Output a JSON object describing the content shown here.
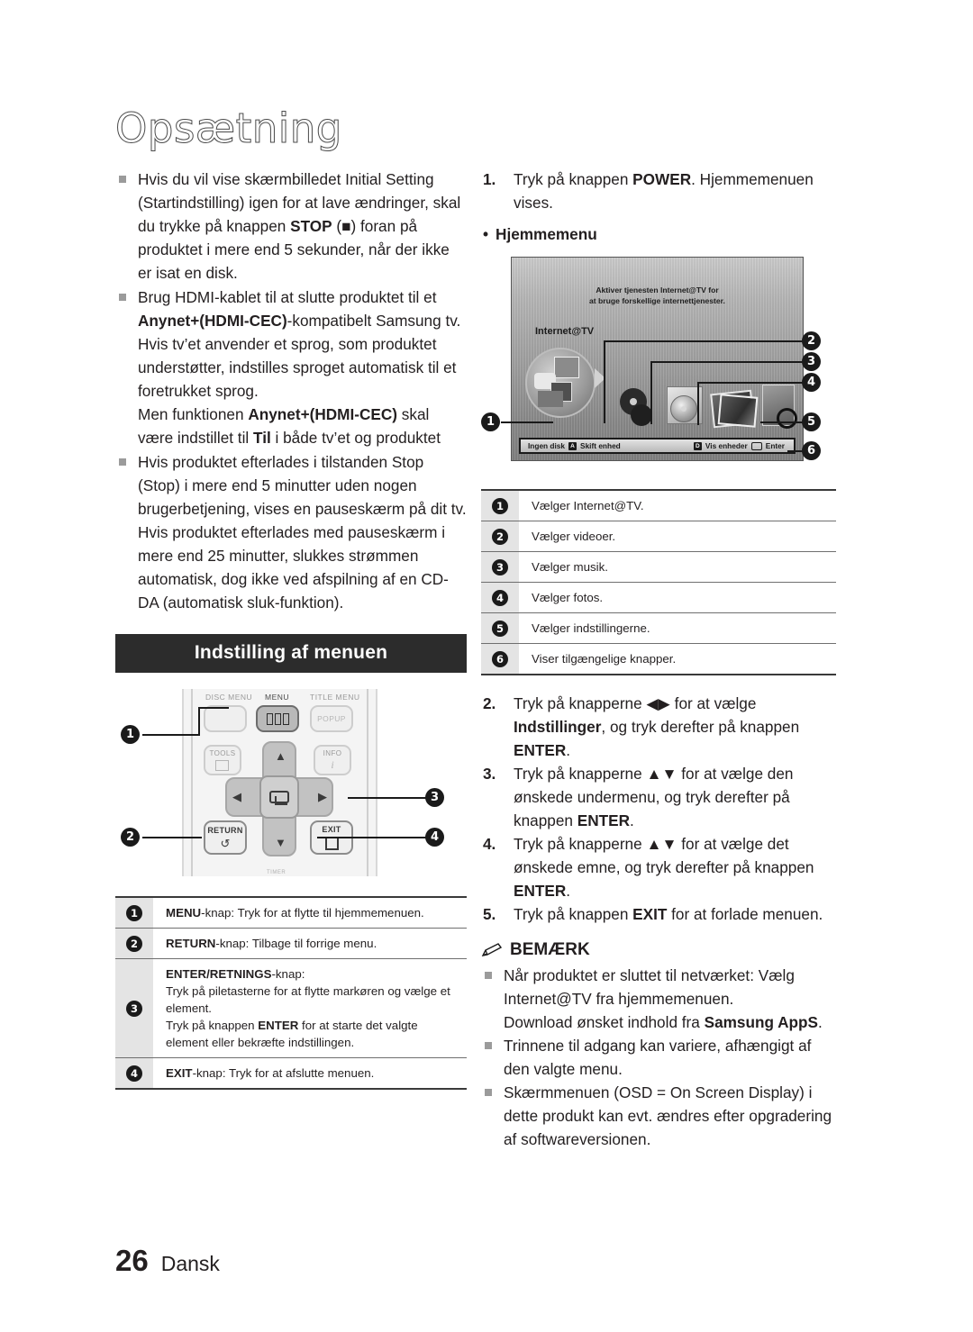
{
  "page": {
    "title": "Opsætning",
    "number": "26",
    "language": "Dansk"
  },
  "left_column": {
    "bullets": [
      {
        "parts": [
          {
            "t": "Hvis du vil vise skærmbilledet Initial Setting (Startindstilling) igen for at lave ændringer, skal du trykke på knappen ",
            "b": false
          },
          {
            "t": "STOP",
            "b": true
          },
          {
            "t": " (■) foran på produktet i mere end 5 sekunder, når der ikke er isat en disk.",
            "b": false
          }
        ]
      },
      {
        "parts": [
          {
            "t": "Brug HDMI-kablet til at slutte produktet til et ",
            "b": false
          },
          {
            "t": "Anynet+(HDMI-CEC)",
            "b": true
          },
          {
            "t": "-kompatibelt Samsung tv. Hvis tv’et anvender et sprog, som produktet understøtter, indstilles sproget automatisk til et foretrukket sprog.",
            "b": false
          },
          {
            "t": "\nMen funktionen ",
            "b": false
          },
          {
            "t": "Anynet+(HDMI-CEC)",
            "b": true
          },
          {
            "t": " skal være indstillet til ",
            "b": false
          },
          {
            "t": "Til",
            "b": true
          },
          {
            "t": " i både tv’et og produktet",
            "b": false
          }
        ]
      },
      {
        "parts": [
          {
            "t": "Hvis produktet efterlades i tilstanden Stop (Stop) i mere end 5 minutter uden nogen brugerbetjening, vises en pauseskærm på dit tv. Hvis produktet efterlades med pauseskærm i mere end 25 minutter, slukkes strømmen automatisk, dog ikke ved afspilning af en CD-DA (automatisk sluk-funktion).",
            "b": false
          }
        ]
      }
    ],
    "section_header": "Indstilling af menuen",
    "remote": {
      "labels": {
        "disc_menu": "DISC MENU",
        "menu": "MENU",
        "title_menu": "TITLE MENU",
        "popup": "POPUP",
        "tools": "TOOLS",
        "info": "INFO",
        "return": "RETURN",
        "exit": "EXIT",
        "timer": "TIMER"
      },
      "callouts": [
        "1",
        "2",
        "3",
        "4"
      ]
    },
    "remote_table": [
      {
        "num": "1",
        "lines": [
          [
            {
              "t": "MENU",
              "b": true
            },
            {
              "t": "-knap: Tryk for at flytte til hjemmemenuen.",
              "b": false
            }
          ]
        ]
      },
      {
        "num": "2",
        "lines": [
          [
            {
              "t": "RETURN",
              "b": true
            },
            {
              "t": "-knap: Tilbage til forrige menu.",
              "b": false
            }
          ]
        ]
      },
      {
        "num": "3",
        "lines": [
          [
            {
              "t": "ENTER/RETNINGS",
              "b": true
            },
            {
              "t": "-knap:",
              "b": false
            }
          ],
          [
            {
              "t": "Tryk på piletasterne for at flytte markøren og vælge et element.",
              "b": false
            }
          ],
          [
            {
              "t": "Tryk på knappen ",
              "b": false
            },
            {
              "t": "ENTER",
              "b": true
            },
            {
              "t": " for at starte det valgte element eller bekræfte indstillingen.",
              "b": false
            }
          ]
        ]
      },
      {
        "num": "4",
        "lines": [
          [
            {
              "t": "EXIT",
              "b": true
            },
            {
              "t": "-knap: Tryk for at afslutte menuen.",
              "b": false
            }
          ]
        ]
      }
    ]
  },
  "right_column": {
    "step1": {
      "num": "1.",
      "parts": [
        {
          "t": "Tryk på knappen ",
          "b": false
        },
        {
          "t": "POWER",
          "b": true
        },
        {
          "t": ". Hjemmemenuen vises.",
          "b": false
        }
      ]
    },
    "sub_bullet": "Hjemmemenu",
    "tv": {
      "caption_line1": "Aktiver tjenesten Internet@TV for",
      "caption_line2": "at bruge forskellige internettjenester.",
      "label_internet_tv": "Internet@TV",
      "bottom_bar": {
        "no_disc": "Ingen disk",
        "badge_a": "A",
        "change_device": "Skift enhed",
        "badge_d": "D",
        "show_devices": "Vis enheder",
        "enter": "Enter"
      },
      "callouts": [
        "1",
        "2",
        "3",
        "4",
        "5",
        "6"
      ]
    },
    "menu_table": [
      {
        "num": "1",
        "text": "Vælger Internet@TV."
      },
      {
        "num": "2",
        "text": "Vælger videoer."
      },
      {
        "num": "3",
        "text": "Vælger musik."
      },
      {
        "num": "4",
        "text": "Vælger fotos."
      },
      {
        "num": "5",
        "text": "Vælger indstillingerne."
      },
      {
        "num": "6",
        "text": "Viser tilgængelige knapper."
      }
    ],
    "steps": [
      {
        "num": "2.",
        "parts": [
          {
            "t": "Tryk på knapperne ",
            "b": false
          },
          {
            "t": "◀▶",
            "b": false
          },
          {
            "t": " for at vælge ",
            "b": false
          },
          {
            "t": "Indstillinger",
            "b": true
          },
          {
            "t": ", og tryk derefter på knappen ",
            "b": false
          },
          {
            "t": "ENTER",
            "b": true
          },
          {
            "t": ".",
            "b": false
          }
        ]
      },
      {
        "num": "3.",
        "parts": [
          {
            "t": "Tryk på knapperne ",
            "b": false
          },
          {
            "t": "▲▼",
            "b": false
          },
          {
            "t": " for at vælge den ønskede undermenu, og tryk derefter på knappen ",
            "b": false
          },
          {
            "t": "ENTER",
            "b": true
          },
          {
            "t": ".",
            "b": false
          }
        ]
      },
      {
        "num": "4.",
        "parts": [
          {
            "t": "Tryk på knapperne ",
            "b": false
          },
          {
            "t": "▲▼",
            "b": false
          },
          {
            "t": " for at vælge det ønskede emne, og tryk derefter på knappen ",
            "b": false
          },
          {
            "t": "ENTER",
            "b": true
          },
          {
            "t": ".",
            "b": false
          }
        ]
      },
      {
        "num": "5.",
        "parts": [
          {
            "t": "Tryk på knappen ",
            "b": false
          },
          {
            "t": "EXIT",
            "b": true
          },
          {
            "t": " for at forlade menuen.",
            "b": false
          }
        ]
      }
    ],
    "note": {
      "heading": "BEMÆRK",
      "items": [
        {
          "parts": [
            {
              "t": "Når produktet er sluttet til netværket: Vælg Internet@TV fra hjemmemenuen.",
              "b": false
            },
            {
              "t": "\nDownload ønsket indhold fra ",
              "b": false
            },
            {
              "t": "Samsung AppS",
              "b": true
            },
            {
              "t": ".",
              "b": false
            }
          ]
        },
        {
          "parts": [
            {
              "t": "Trinnene til adgang kan variere, afhængigt af den valgte menu.",
              "b": false
            }
          ]
        },
        {
          "parts": [
            {
              "t": "Skærmmenuen (OSD = On Screen Display) i dette produkt kan evt. ændres efter opgradering af softwareversionen.",
              "b": false
            }
          ]
        }
      ]
    }
  },
  "colors": {
    "section_bar_bg": "#2c2c2c",
    "callout_bg": "#1a1a1a",
    "table_numcell_bg": "#e4e4e4",
    "bullet_square": "#9b9b9b"
  }
}
